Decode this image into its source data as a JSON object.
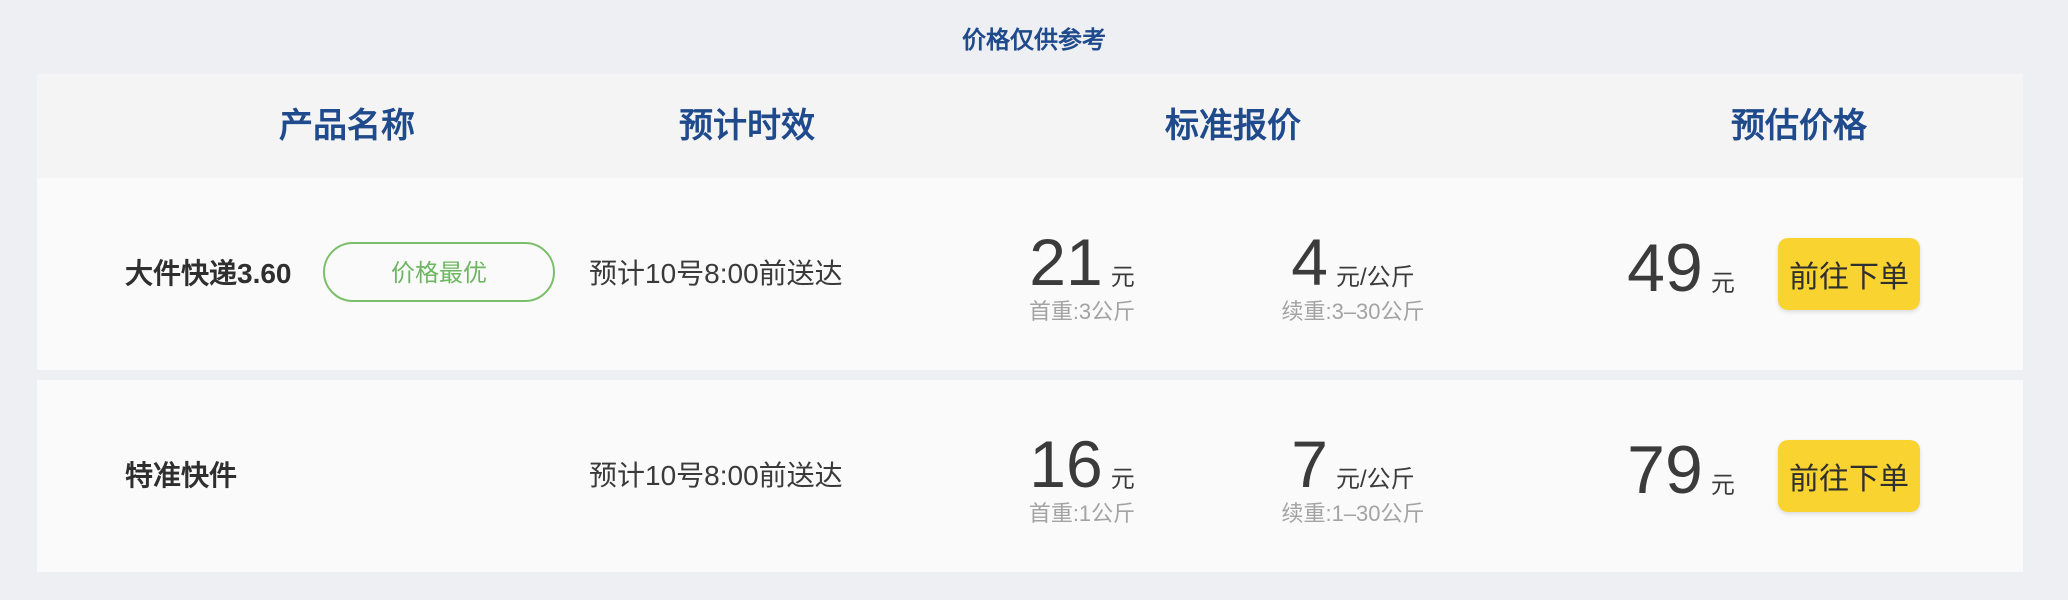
{
  "notice": "价格仅供参考",
  "columns": {
    "product": "产品名称",
    "eta": "预计时效",
    "standard": "标准报价",
    "estimate": "预估价格"
  },
  "rows": [
    {
      "name": "大件快递3.60",
      "badge": "价格最优",
      "eta": "预计10号8:00前送达",
      "first_price": "21",
      "first_unit": "元",
      "first_note": "首重:3公斤",
      "cont_price": "4",
      "cont_unit": "元/公斤",
      "cont_note": "续重:3–30公斤",
      "estimate": "49",
      "estimate_unit": "元",
      "button": "前往下单"
    },
    {
      "name": "特准快件",
      "eta": "预计10号8:00前送达",
      "first_price": "16",
      "first_unit": "元",
      "first_note": "首重:1公斤",
      "cont_price": "7",
      "cont_unit": "元/公斤",
      "cont_note": "续重:1–30公斤",
      "estimate": "79",
      "estimate_unit": "元",
      "button": "前往下单"
    }
  ],
  "colors": {
    "header_text": "#1f4a8c",
    "badge_border": "#7cbf6b",
    "button_bg": "#f9d32f",
    "page_bg": "#eeeff3"
  }
}
